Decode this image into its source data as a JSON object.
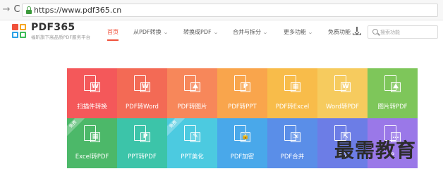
{
  "browser": {
    "url": "https://www.pdf365.cn",
    "back_glyph": "→",
    "reload_glyph": "C",
    "back_icon": "back-arrow-icon",
    "reload_icon": "reload-icon",
    "lock_icon": "lock-icon",
    "lock_color": "#3c9a3c"
  },
  "header": {
    "brand": "PDF365",
    "slogan": "福昕旗下高品质PDF服务平台",
    "logo_icon": "four-squares-logo",
    "accent_color": "#f0513b",
    "menu": [
      {
        "label": "首页",
        "active": true,
        "dropdown": false
      },
      {
        "label": "从PDF转换",
        "active": false,
        "dropdown": true
      },
      {
        "label": "转换成PDF",
        "active": false,
        "dropdown": true
      },
      {
        "label": "合并与拆分",
        "active": false,
        "dropdown": true
      },
      {
        "label": "更多功能",
        "active": false,
        "dropdown": true
      },
      {
        "label": "免费功能",
        "active": false,
        "dropdown": false
      }
    ],
    "chevron": "⌄",
    "download_icon": "download-icon",
    "search_placeholder": "搜索功能",
    "search_icon": "search-icon"
  },
  "tools": [
    {
      "label": "扫描件转换",
      "color": "#f4585a",
      "badge": "W",
      "free": false,
      "icon": "scan-to-word-icon"
    },
    {
      "label": "PDF转Word",
      "color": "#f36a55",
      "badge": "W",
      "free": false,
      "icon": "pdf-to-word-icon"
    },
    {
      "label": "PDF转图片",
      "color": "#f7875a",
      "badge": "⛰",
      "free": false,
      "icon": "pdf-to-image-icon"
    },
    {
      "label": "PDF转PPT",
      "color": "#f9a54c",
      "badge": "P",
      "free": false,
      "icon": "pdf-to-ppt-icon"
    },
    {
      "label": "PDF转Excel",
      "color": "#f8bc4a",
      "badge": "▦",
      "free": false,
      "icon": "pdf-to-excel-icon"
    },
    {
      "label": "Word转PDF",
      "color": "#f6cb5e",
      "badge": "W",
      "free": false,
      "icon": "word-to-pdf-icon"
    },
    {
      "label": "图片转PDF",
      "color": "#7ec65a",
      "badge": "⛰",
      "free": false,
      "icon": "image-to-pdf-icon"
    },
    {
      "label": "Excel转PDF",
      "color": "#4cb869",
      "badge": "▦",
      "free": true,
      "free_text": "免费",
      "icon": "excel-to-pdf-icon"
    },
    {
      "label": "PPT转PDF",
      "color": "#3cc4a9",
      "badge": "P",
      "free": false,
      "icon": "ppt-to-pdf-icon"
    },
    {
      "label": "PPT美化",
      "color": "#4ccae0",
      "badge": "✎",
      "free": true,
      "free_text": "免费",
      "icon": "ppt-beautify-icon"
    },
    {
      "label": "PDF加密",
      "color": "#49a8ea",
      "badge": "🔒",
      "free": false,
      "icon": "pdf-encrypt-icon"
    },
    {
      "label": "PDF合并",
      "color": "#5a8ee8",
      "badge": "⇲",
      "free": false,
      "icon": "pdf-merge-icon"
    },
    {
      "label": "PD",
      "color": "#6c7de6",
      "badge": "⇱",
      "free": false,
      "icon": "pdf-split-icon"
    },
    {
      "label": "P",
      "color": "#9a78e8",
      "badge": "…",
      "free": false,
      "icon": "more-tools-icon"
    }
  ],
  "watermark": "最需教育"
}
